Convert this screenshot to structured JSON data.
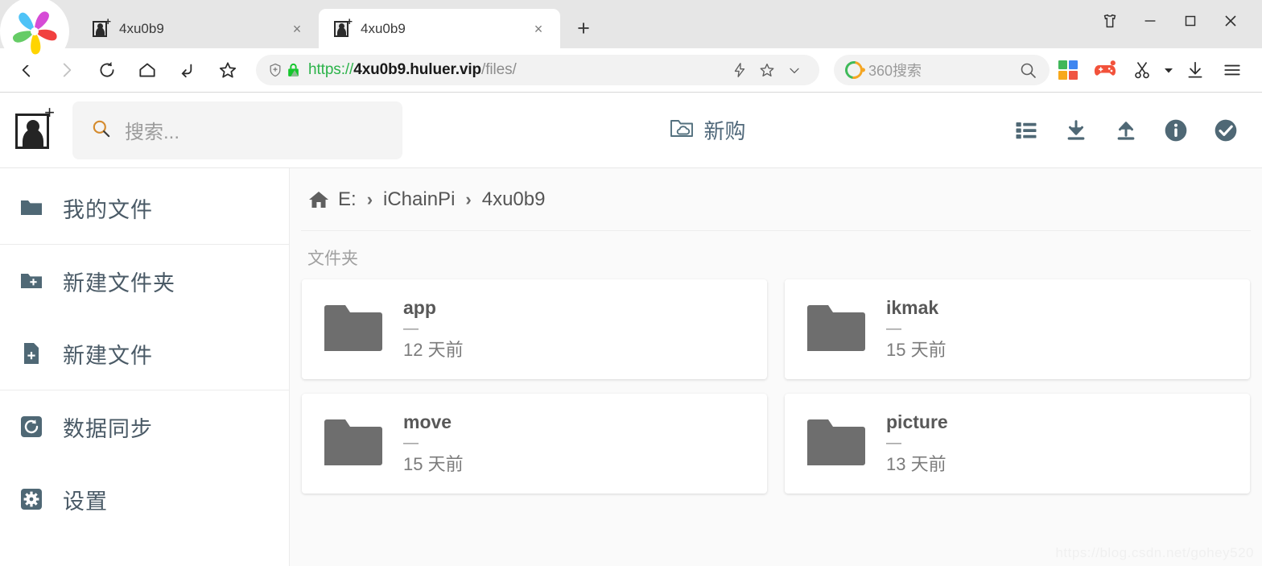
{
  "browser": {
    "tabs": [
      {
        "title": "4xu0b9",
        "active": false,
        "favicon": "snowman-favicon",
        "close": "×"
      },
      {
        "title": "4xu0b9",
        "active": true,
        "favicon": "snowman-favicon",
        "close": "×"
      }
    ],
    "new_tab_label": "+",
    "window_controls": [
      {
        "name": "skin-button",
        "glyph": "▽"
      },
      {
        "name": "minimize-button",
        "glyph": "─"
      },
      {
        "name": "maximize-button",
        "glyph": "□"
      },
      {
        "name": "close-button",
        "glyph": "✕"
      }
    ],
    "nav": {
      "back": "back-icon",
      "forward": "forward-icon",
      "reload": "reload-icon",
      "home": "home-icon",
      "undo": "undo-icon",
      "bookmark": "star-icon"
    },
    "address": {
      "shield": "shield-icon",
      "lock": "lock-icon",
      "scheme": "https://",
      "host": "4xu0b9.huluer.vip",
      "path": "/files/",
      "lightning": "lightning-icon",
      "star": "star-outline-icon",
      "chevron": "chevron-down-icon"
    },
    "search": {
      "engine_icon": "360-logo-icon",
      "placeholder": "360搜索",
      "submit_icon": "search-icon"
    },
    "extensions": [
      {
        "name": "apps-grid-icon",
        "colors": [
          "#41b75a",
          "#3f86f0",
          "#f7a81b",
          "#f05542"
        ]
      },
      {
        "name": "game-controller-icon",
        "color": "#f2523b"
      },
      {
        "name": "scissors-icon",
        "color": "#2c2c2c"
      },
      {
        "name": "scissors-dropdown-icon",
        "color": "#2c2c2c"
      },
      {
        "name": "download-icon",
        "color": "#2c2c2c"
      },
      {
        "name": "menu-icon",
        "color": "#2c2c2c"
      }
    ]
  },
  "app": {
    "logo": "snowman-app-logo",
    "search": {
      "placeholder": "搜索...",
      "icon": "search-icon"
    },
    "buy": {
      "label": "新购",
      "icon": "folder-cloud-icon"
    },
    "actions": [
      {
        "name": "list-view-button",
        "icon": "list-icon"
      },
      {
        "name": "download-button",
        "icon": "download-icon"
      },
      {
        "name": "upload-button",
        "icon": "upload-icon"
      },
      {
        "name": "info-button",
        "icon": "info-circle-icon"
      },
      {
        "name": "select-all-button",
        "icon": "check-circle-icon"
      }
    ],
    "accent": "#4f6875",
    "sidebar": {
      "groups": [
        {
          "items": [
            {
              "label": "我的文件",
              "icon": "folder-icon",
              "name": "sidebar-item-my-files"
            }
          ]
        },
        {
          "items": [
            {
              "label": "新建文件夹",
              "icon": "folder-plus-icon",
              "name": "sidebar-item-new-folder"
            },
            {
              "label": "新建文件",
              "icon": "file-plus-icon",
              "name": "sidebar-item-new-file"
            }
          ]
        },
        {
          "items": [
            {
              "label": "数据同步",
              "icon": "sync-icon",
              "name": "sidebar-item-sync"
            },
            {
              "label": "设置",
              "icon": "gear-icon",
              "name": "sidebar-item-settings"
            }
          ]
        }
      ]
    },
    "breadcrumb": {
      "home_icon": "home-icon",
      "separator": "›",
      "items": [
        "E:",
        "iChainPi",
        "4xu0b9"
      ]
    },
    "section_label": "文件夹",
    "folders": [
      {
        "name": "app",
        "size": "—",
        "date": "12 天前"
      },
      {
        "name": "ikmak",
        "size": "—",
        "date": "15 天前"
      },
      {
        "name": "move",
        "size": "—",
        "date": "15 天前"
      },
      {
        "name": "picture",
        "size": "—",
        "date": "13 天前"
      }
    ],
    "watermark": "https://blog.csdn.net/gohey520"
  }
}
